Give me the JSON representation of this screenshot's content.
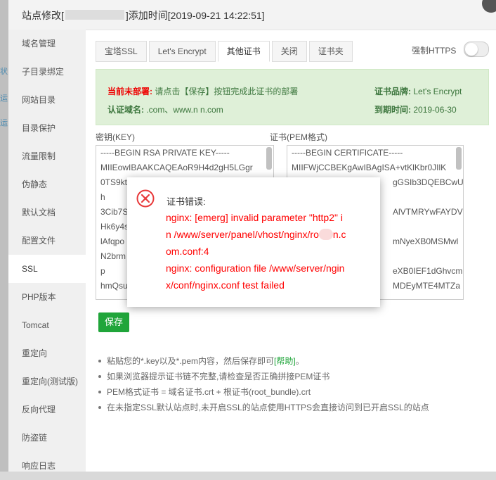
{
  "window": {
    "title_prefix": "站点修改[",
    "title_suffix": "]添加时间[2019-09-21 14:22:51]"
  },
  "background_edge": [
    "状",
    "运",
    "运"
  ],
  "sidebar": {
    "items": [
      {
        "label": "域名管理"
      },
      {
        "label": "子目录绑定"
      },
      {
        "label": "网站目录"
      },
      {
        "label": "目录保护"
      },
      {
        "label": "流量限制"
      },
      {
        "label": "伪静态"
      },
      {
        "label": "默认文档"
      },
      {
        "label": "配置文件"
      },
      {
        "label": "SSL",
        "active": true
      },
      {
        "label": "PHP版本"
      },
      {
        "label": "Tomcat"
      },
      {
        "label": "重定向"
      },
      {
        "label": "重定向(测试版)"
      },
      {
        "label": "反向代理"
      },
      {
        "label": "防盗链"
      },
      {
        "label": "响应日志"
      }
    ]
  },
  "tabs": [
    "宝塔SSL",
    "Let's Encrypt",
    "其他证书",
    "关闭",
    "证书夹"
  ],
  "active_tab": "其他证书",
  "force_https": {
    "label": "强制HTTPS",
    "enabled": false
  },
  "info": {
    "deploy_label": "当前未部署:",
    "deploy_text": "请点击【保存】按钮完成此证书的部署",
    "domain_label": "认证域名:",
    "domain_value": ".com、www.n  n.com",
    "brand_label": "证书品牌:",
    "brand_value": "Let's Encrypt",
    "expire_label": "到期时间:",
    "expire_value": "2019-06-30"
  },
  "key_field": {
    "label": "密钥(KEY)",
    "lines": [
      "-----BEGIN RSA PRIVATE KEY-----",
      "MIIEowIBAAKCAQEAoR9H4d2gH5LGgr",
      "0TS9kt",
      "h",
      "3Cib7S",
      "Hk6y4s",
      "lAfqpo",
      "N2brm",
      "p",
      "hmQsu"
    ]
  },
  "cert_field": {
    "label": "证书(PEM格式)",
    "lines": [
      "-----BEGIN CERTIFICATE-----",
      "MIIFWjCCBEKgAwIBAgISA+vtKlKbr0JIlK",
      "gGSIb3DQEBCwU",
      "",
      "AlVTMRYwFAYDV",
      "",
      "mNyeXB0MSMwl",
      "",
      "eXB0IEF1dGhvcml",
      "MDEyMTE4MTZa"
    ]
  },
  "save_button": "保存",
  "tips": {
    "tip1_text": "粘贴您的*.key以及*.pem内容，然后保存即可",
    "tip1_link": "[帮助]",
    "tip1_end": "。",
    "tip2": "如果浏览器提示证书链不完整,请检查是否正确拼接PEM证书",
    "tip3": "PEM格式证书 = 域名证书.crt + 根证书(root_bundle).crt",
    "tip4": "在未指定SSL默认站点时,未开启SSL的站点使用HTTPS会直接访问到已开启SSL的站点"
  },
  "dialog": {
    "title": "证书错误:",
    "line1": "nginx: [emerg] invalid parameter \"http2\" i",
    "line2": "n /www/server/panel/vhost/nginx/ro",
    "line2_end": "n.c",
    "line3": "om.conf:4",
    "line4": "nginx: configuration file /www/server/ngin",
    "line5": "x/conf/nginx.conf test failed",
    "icon": "error-circle-x-icon",
    "color": "#ff0000"
  },
  "colors": {
    "accent": "#20a53a",
    "error": "#ff0000",
    "info_bg": "#dff0d8"
  }
}
